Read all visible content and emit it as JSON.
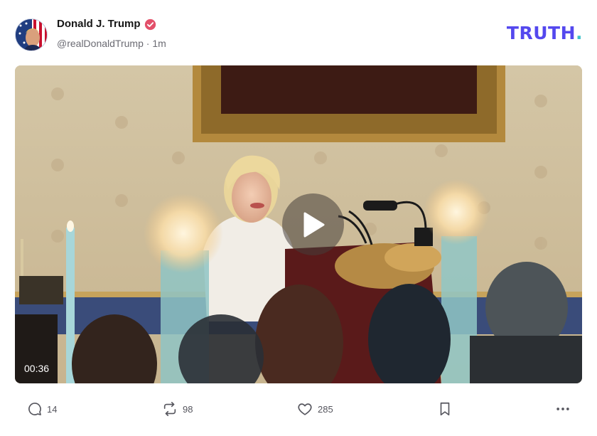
{
  "post": {
    "author_name": "Donald J. Trump",
    "handle": "@realDonaldTrump",
    "separator": " · ",
    "time_ago": "1m",
    "verified": true
  },
  "brand": {
    "logo_text": "TRUTH",
    "logo_dot": ".",
    "logo_color": "#5448ee",
    "dot_color": "#3fc2c9"
  },
  "media": {
    "type": "video",
    "duration": "00:36",
    "play_icon": "play-icon"
  },
  "actions": {
    "reply_count": "14",
    "retruth_count": "98",
    "like_count": "285"
  },
  "icons": {
    "reply": "comment-icon",
    "retruth": "retruth-icon",
    "like": "heart-icon",
    "bookmark": "bookmark-icon",
    "more": "more-icon",
    "verified": "verified-badge-icon"
  },
  "colors": {
    "verified_badge": "#e3506a",
    "text_muted": "#6b6b73"
  }
}
